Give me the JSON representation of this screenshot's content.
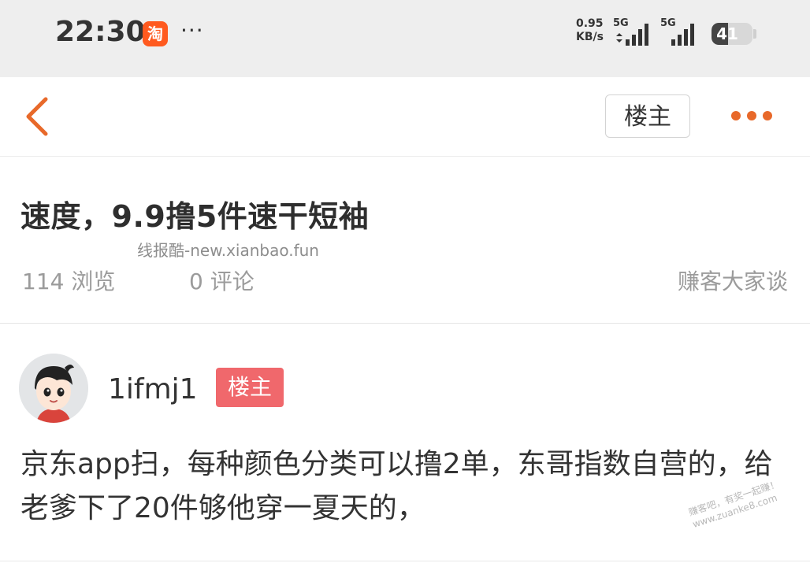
{
  "status_bar": {
    "time": "22:30",
    "app_icon_text": "淘",
    "more_dots": "···",
    "net_speed_value": "0.95",
    "net_speed_unit": "KB/s",
    "sim1_label": "5G",
    "sim2_label": "5G",
    "battery_level": "41",
    "battery_fraction": 0.41
  },
  "nav": {
    "owner_button_label": "楼主"
  },
  "post": {
    "title": "速度，9.9撸5件速干短袖",
    "watermark": "线报酷-new.xianbao.fun",
    "views": "114 浏览",
    "comments": "0 评论",
    "category": "赚客大家谈"
  },
  "author": {
    "username": "1ifmj1",
    "badge": "楼主"
  },
  "body": {
    "text": "京东app扫，每种颜色分类可以撸2单，东哥指数自营的，给老爹下了20件够他穿一夏天的，"
  },
  "stamp": {
    "line1": "赚客吧，有奖一起赚！",
    "line2": "www.zuanke8.com"
  },
  "colors": {
    "accent_orange": "#e8692a",
    "badge_red": "#f0686c",
    "taobao_orange": "#ff5a1f"
  }
}
